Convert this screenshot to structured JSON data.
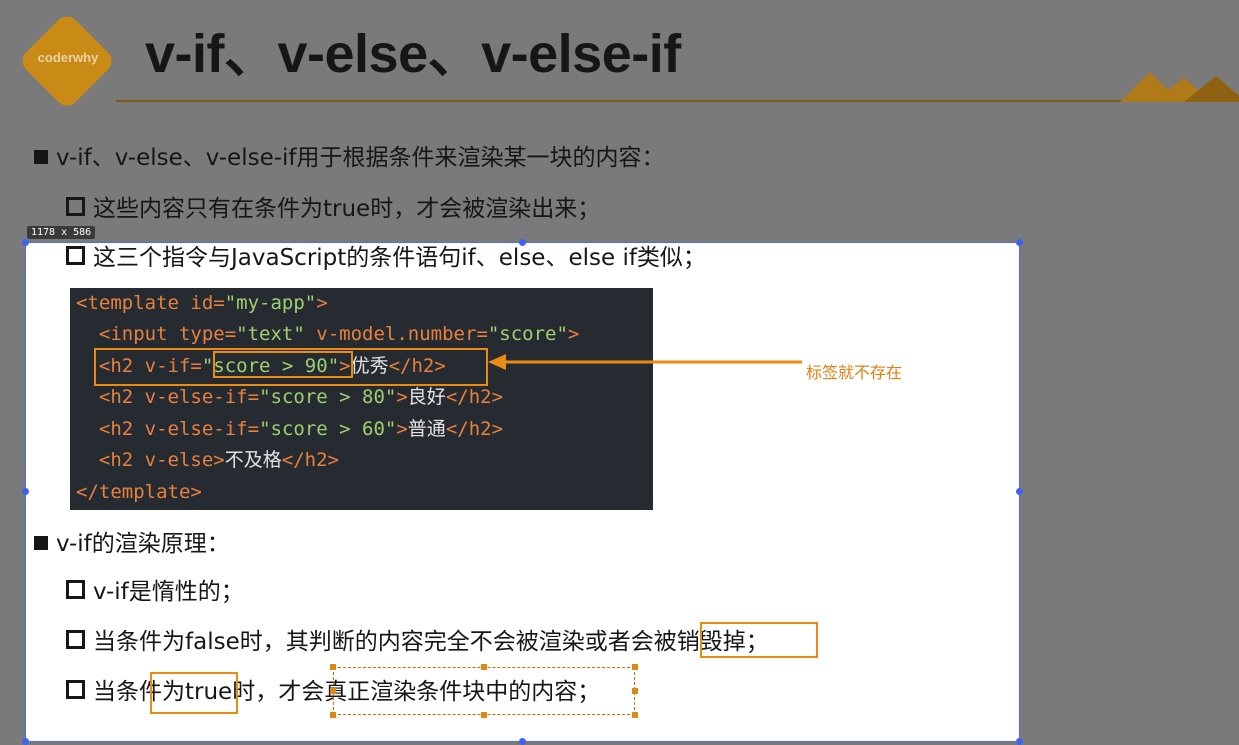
{
  "header": {
    "logo_text": "coderwhy",
    "title": "v-if、v-else、v-else-if"
  },
  "bullets": {
    "b1": "v-if、v-else、v-else-if用于根据条件来渲染某一块的内容：",
    "b1_1": "这些内容只有在条件为true时，才会被渲染出来；",
    "b1_2": "这三个指令与JavaScript的条件语句if、else、else if类似；",
    "b2": "v-if的渲染原理：",
    "b2_1": "v-if是惰性的；",
    "b2_2_pre": "当条件为false时，其判断的内容完全不会被渲染或者会",
    "b2_2_hl": "被销毁掉",
    "b2_2_post": "；",
    "b2_3": "当条件为true时，才会真正渲染条件块中的内容；"
  },
  "selection": {
    "size_label": "1178 x 586"
  },
  "code": {
    "l1_open": "<template",
    "l1_attr": " id=",
    "l1_val": "\"my-app\"",
    "l1_close": ">",
    "l2_indent": "  ",
    "l2_open": "<input",
    "l2_attr1": " type=",
    "l2_val1": "\"text\"",
    "l2_attr2": " v-model.number=",
    "l2_val2": "\"score\"",
    "l2_close": ">",
    "l3_indent": "  ",
    "l3_open": "<h2",
    "l3_attr": " v-if=",
    "l3_val": "\"score > 90\"",
    "l3_gt": ">",
    "l3_text": "优秀",
    "l3_end": "</h2>",
    "l4_indent": "  ",
    "l4_open": "<h2",
    "l4_attr": " v-else-if=",
    "l4_val": "\"score > 80\"",
    "l4_gt": ">",
    "l4_text": "良好",
    "l4_end": "</h2>",
    "l5_indent": "  ",
    "l5_open": "<h2",
    "l5_attr": " v-else-if=",
    "l5_val": "\"score > 60\"",
    "l5_gt": ">",
    "l5_text": "普通",
    "l5_end": "</h2>",
    "l6_indent": "  ",
    "l6_open": "<h2",
    "l6_attr": " v-else",
    "l6_gt": ">",
    "l6_text": "不及格",
    "l6_end": "</h2>",
    "l7": "</template>"
  },
  "annotation": {
    "note": "标签就不存在"
  },
  "colors": {
    "accent_orange": "#e88c12",
    "selection_blue": "#4a6cf7"
  }
}
